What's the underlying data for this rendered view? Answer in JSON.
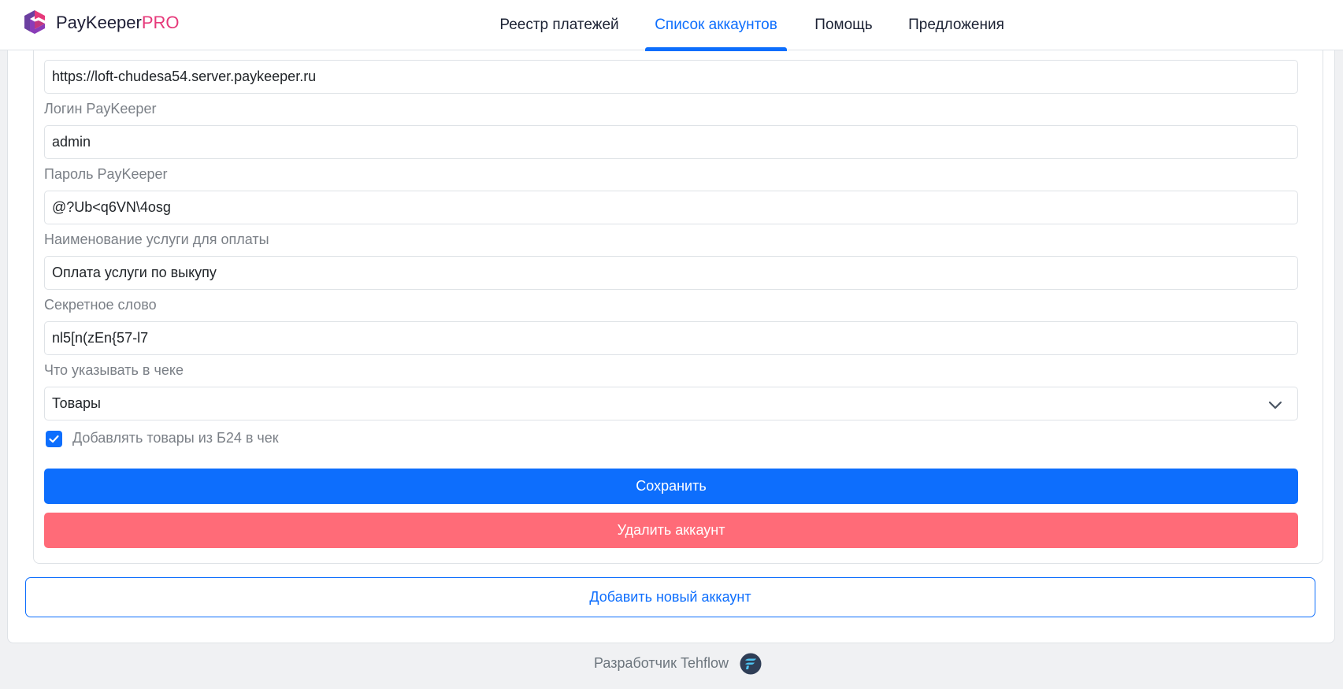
{
  "header": {
    "brand_main": "PayKeeper",
    "brand_pro": "PRO",
    "nav": [
      {
        "label": "Реестр платежей",
        "active": false
      },
      {
        "label": "Список аккаунтов",
        "active": true
      },
      {
        "label": "Помощь",
        "active": false
      },
      {
        "label": "Предложения",
        "active": false
      }
    ]
  },
  "form": {
    "server_url": "https://loft-chudesa54.server.paykeeper.ru",
    "login_label": "Логин PayKeeper",
    "login_value": "admin",
    "password_label": "Пароль PayKeeper",
    "password_value": "@?Ub<q6VN\\4osg",
    "service_label": "Наименование услуги для оплаты",
    "service_value": "Оплата услуги по выкупу",
    "secret_label": "Секретное слово",
    "secret_value": "nl5[n(zEn{57-l7",
    "receipt_label": "Что указывать в чеке",
    "receipt_value": "Товары",
    "add_goods_label": "Добавлять товары из Б24 в чек",
    "add_goods_checked": true,
    "save_label": "Сохранить",
    "delete_label": "Удалить аккаунт"
  },
  "add_account_label": "Добавить новый аккаунт",
  "footer": {
    "developer_text": "Разработчик Tehflow"
  },
  "colors": {
    "primary": "#0d6efd",
    "danger": "#ff6b78",
    "brand_pro": "#e6397a"
  }
}
